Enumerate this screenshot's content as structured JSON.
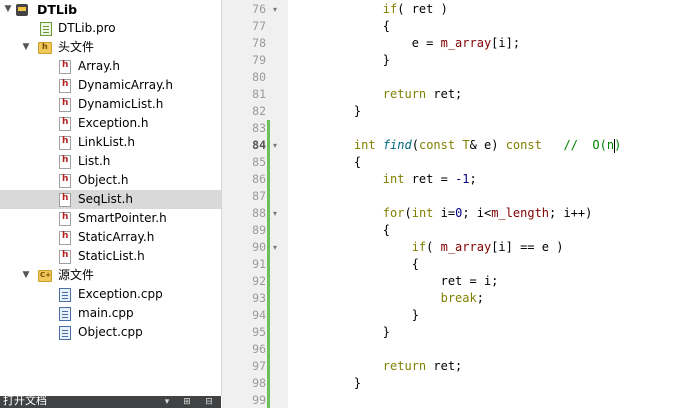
{
  "project_tree": {
    "root": "DTLib",
    "pro_file": "DTLib.pro",
    "headers_folder": "头文件",
    "headers": [
      "Array.h",
      "DynamicArray.h",
      "DynamicList.h",
      "Exception.h",
      "LinkList.h",
      "List.h",
      "Object.h",
      "SeqList.h",
      "SmartPointer.h",
      "StaticArray.h",
      "StaticList.h"
    ],
    "selected": "SeqList.h",
    "sources_folder": "源文件",
    "sources": [
      "Exception.cpp",
      "main.cpp",
      "Object.cpp"
    ]
  },
  "bottom_panel": {
    "title": "打开文档",
    "buttons": [
      "▾",
      "⊞",
      "⊟"
    ]
  },
  "editor": {
    "current_line": 84,
    "lines": [
      {
        "n": 76,
        "code": "        if( ret )"
      },
      {
        "n": 77,
        "code": "        {"
      },
      {
        "n": 78,
        "code": "            e = m_array[i];"
      },
      {
        "n": 79,
        "code": "        }"
      },
      {
        "n": 80,
        "code": ""
      },
      {
        "n": 81,
        "code": "        return ret;"
      },
      {
        "n": 82,
        "code": "    }"
      },
      {
        "n": 83,
        "code": ""
      },
      {
        "n": 84,
        "code": "    int find(const T& e) const   //  O(n)"
      },
      {
        "n": 85,
        "code": "    {"
      },
      {
        "n": 86,
        "code": "        int ret = -1;"
      },
      {
        "n": 87,
        "code": ""
      },
      {
        "n": 88,
        "code": "        for(int i=0; i<m_length; i++)"
      },
      {
        "n": 89,
        "code": "        {"
      },
      {
        "n": 90,
        "code": "            if( m_array[i] == e )"
      },
      {
        "n": 91,
        "code": "            {"
      },
      {
        "n": 92,
        "code": "                ret = i;"
      },
      {
        "n": 93,
        "code": "                break;"
      },
      {
        "n": 94,
        "code": "            }"
      },
      {
        "n": 95,
        "code": "        }"
      },
      {
        "n": 96,
        "code": ""
      },
      {
        "n": 97,
        "code": "        return ret;"
      },
      {
        "n": 98,
        "code": "    }"
      },
      {
        "n": 99,
        "code": ""
      }
    ]
  },
  "colors": {
    "keyword": "#808000",
    "comment": "#008000",
    "function": "#00677c",
    "number": "#000080",
    "member": "#800000",
    "changed_marker": "#6dbf5a",
    "selection": "#d9d9d9"
  }
}
